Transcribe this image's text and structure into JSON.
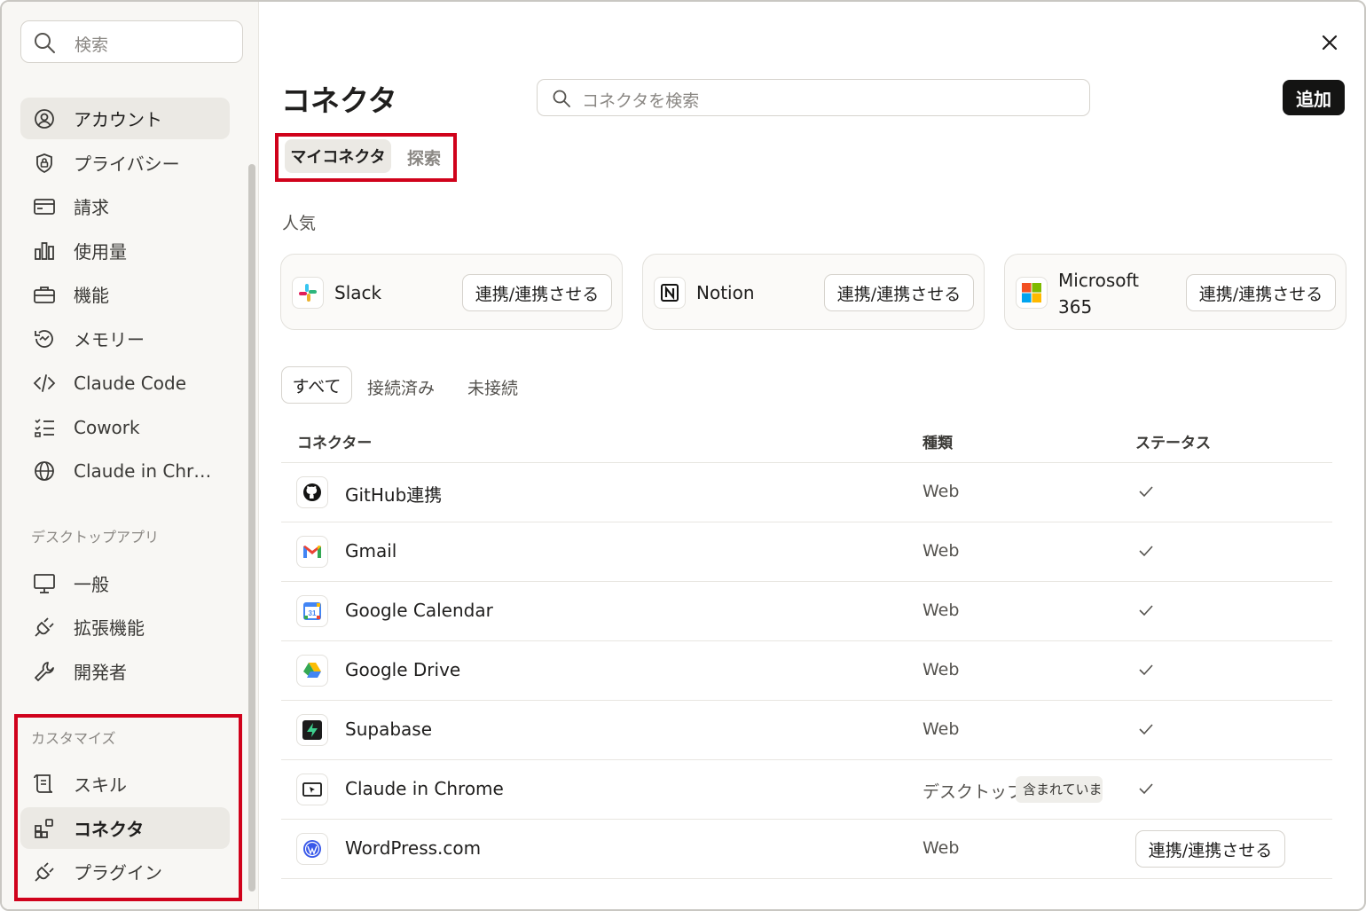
{
  "sidebar": {
    "search_placeholder": "検索",
    "items": [
      {
        "label": "アカウント",
        "icon": "account-icon",
        "active": true
      },
      {
        "label": "プライバシー",
        "icon": "privacy-icon"
      },
      {
        "label": "請求",
        "icon": "billing-icon"
      },
      {
        "label": "使用量",
        "icon": "usage-icon"
      },
      {
        "label": "機能",
        "icon": "features-icon"
      },
      {
        "label": "メモリー",
        "icon": "memory-icon"
      },
      {
        "label": "Claude Code",
        "icon": "code-icon"
      },
      {
        "label": "Cowork",
        "icon": "cowork-icon"
      },
      {
        "label": "Claude in Chr…",
        "icon": "globe-icon"
      }
    ],
    "desktop_section": "デスクトップアプリ",
    "desktop_items": [
      {
        "label": "一般",
        "icon": "monitor-icon"
      },
      {
        "label": "拡張機能",
        "icon": "plug-icon"
      },
      {
        "label": "開発者",
        "icon": "wrench-icon"
      }
    ],
    "customize_section": "カスタマイズ",
    "customize_items": [
      {
        "label": "スキル",
        "icon": "scroll-icon"
      },
      {
        "label": "コネクタ",
        "icon": "connector-icon",
        "active": true
      },
      {
        "label": "プラグイン",
        "icon": "plugin-icon"
      }
    ]
  },
  "main": {
    "title": "コネクタ",
    "search_placeholder": "コネクタを検索",
    "add_button": "追加",
    "tabs": [
      {
        "label": "マイコネクタ",
        "active": true
      },
      {
        "label": "探索"
      }
    ],
    "popular_label": "人気",
    "popular": [
      {
        "name": "Slack",
        "button": "連携/連携させる",
        "icon": "slack-icon"
      },
      {
        "name": "Notion",
        "button": "連携/連携させる",
        "icon": "notion-icon"
      },
      {
        "name": "Microsoft 365",
        "button": "連携/連携させる",
        "icon": "microsoft-icon"
      }
    ],
    "filters": [
      {
        "label": "すべて",
        "active": true
      },
      {
        "label": "接続済み"
      },
      {
        "label": "未接続"
      }
    ],
    "columns": [
      "コネクター",
      "種類",
      "ステータス"
    ],
    "rows": [
      {
        "name": "GitHub連携",
        "type": "Web",
        "status": "connected",
        "icon": "github-icon"
      },
      {
        "name": "Gmail",
        "type": "Web",
        "status": "connected",
        "icon": "gmail-icon"
      },
      {
        "name": "Google Calendar",
        "type": "Web",
        "status": "connected",
        "icon": "calendar-icon"
      },
      {
        "name": "Google Drive",
        "type": "Web",
        "status": "connected",
        "icon": "drive-icon"
      },
      {
        "name": "Supabase",
        "type": "Web",
        "status": "connected",
        "icon": "supabase-icon"
      },
      {
        "name": "Claude in Chrome",
        "type": "デスクトップ",
        "badge": "含まれています",
        "status": "connected",
        "icon": "chrome-ext-icon"
      },
      {
        "name": "WordPress.com",
        "type": "Web",
        "status": "disconnected",
        "button": "連携/連携させる",
        "icon": "wordpress-icon"
      }
    ]
  },
  "colors": {
    "accent_black": "#141413",
    "highlight_red": "#d0021b",
    "sidebar_bg": "#f8f7f4"
  }
}
